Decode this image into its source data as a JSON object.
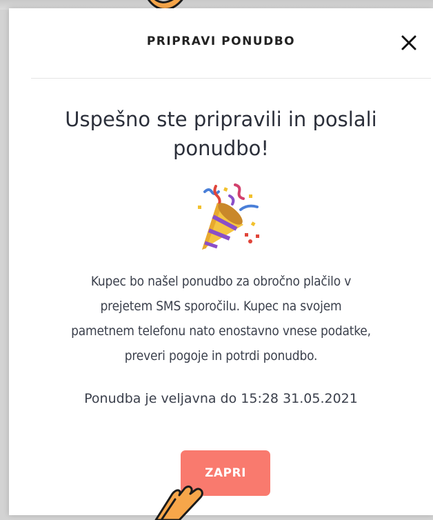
{
  "modal": {
    "title": "PRIPRAVI PONUDBO",
    "headline_line1": "Uspešno ste pripravili in poslali",
    "headline_line2": "ponudbo!",
    "body_lines": [
      "Kupec bo našel ponudbo za obročno plačilo v",
      "prejetem SMS sporočilu. Kupec na svojem",
      "pametnem telefonu nato enostavno vnese podatke,",
      "preveri pogoje in potrdi ponudbo."
    ],
    "validity": "Ponudba je veljavna do 15:28 31.05.2021",
    "close_button_label": "ZAPRI",
    "icons": {
      "close": "close-icon",
      "celebration": "party-popper-icon",
      "pointer": "pointing-hand-icon"
    }
  },
  "colors": {
    "primary_button": "#f97a6e",
    "text": "#2b2f3a",
    "backdrop": "#d3d3d3"
  }
}
